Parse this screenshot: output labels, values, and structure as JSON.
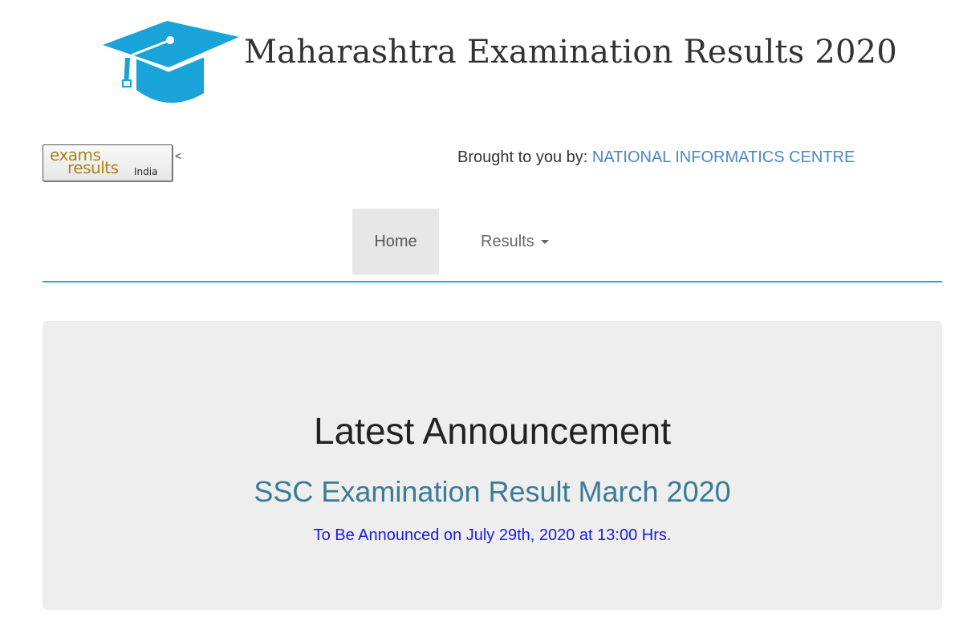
{
  "header": {
    "title": "Maharashtra Examination Results 2020",
    "logo_icon": "graduation-cap-icon",
    "brand_color": "#19a3d8"
  },
  "subheader": {
    "partner_logo": {
      "line1": "exams",
      "line2": "results",
      "line3": "India"
    },
    "stray_char": "<",
    "brought_by_label": "Brought to you by:",
    "brought_by_link": "NATIONAL INFORMATICS CENTRE"
  },
  "nav": {
    "items": [
      {
        "label": "Home",
        "active": true
      },
      {
        "label": "Results",
        "dropdown": true
      }
    ],
    "accent_color": "#29a6d6"
  },
  "announcement": {
    "heading": "Latest Announcement",
    "title": "SSC Examination Result March 2020",
    "date_text": "To Be Announced on July 29th, 2020 at 13:00 Hrs."
  }
}
